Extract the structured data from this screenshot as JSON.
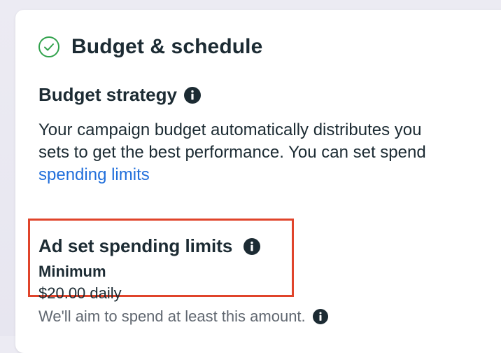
{
  "section": {
    "title": "Budget & schedule"
  },
  "budget_strategy": {
    "title": "Budget strategy",
    "description_line1": "Your campaign budget automatically distributes you",
    "description_line2": "sets to get the best performance. You can set spend",
    "link_label": "spending limits"
  },
  "spending_limits": {
    "title": "Ad set spending limits",
    "minimum_label": "Minimum",
    "minimum_value": "$20.00 daily",
    "hint": "We'll aim to spend at least this amount."
  },
  "colors": {
    "highlight_border": "#e0442b",
    "link": "#216fdb",
    "check_green": "#31a24c"
  },
  "icons": [
    "check-circle-icon",
    "info-icon"
  ]
}
